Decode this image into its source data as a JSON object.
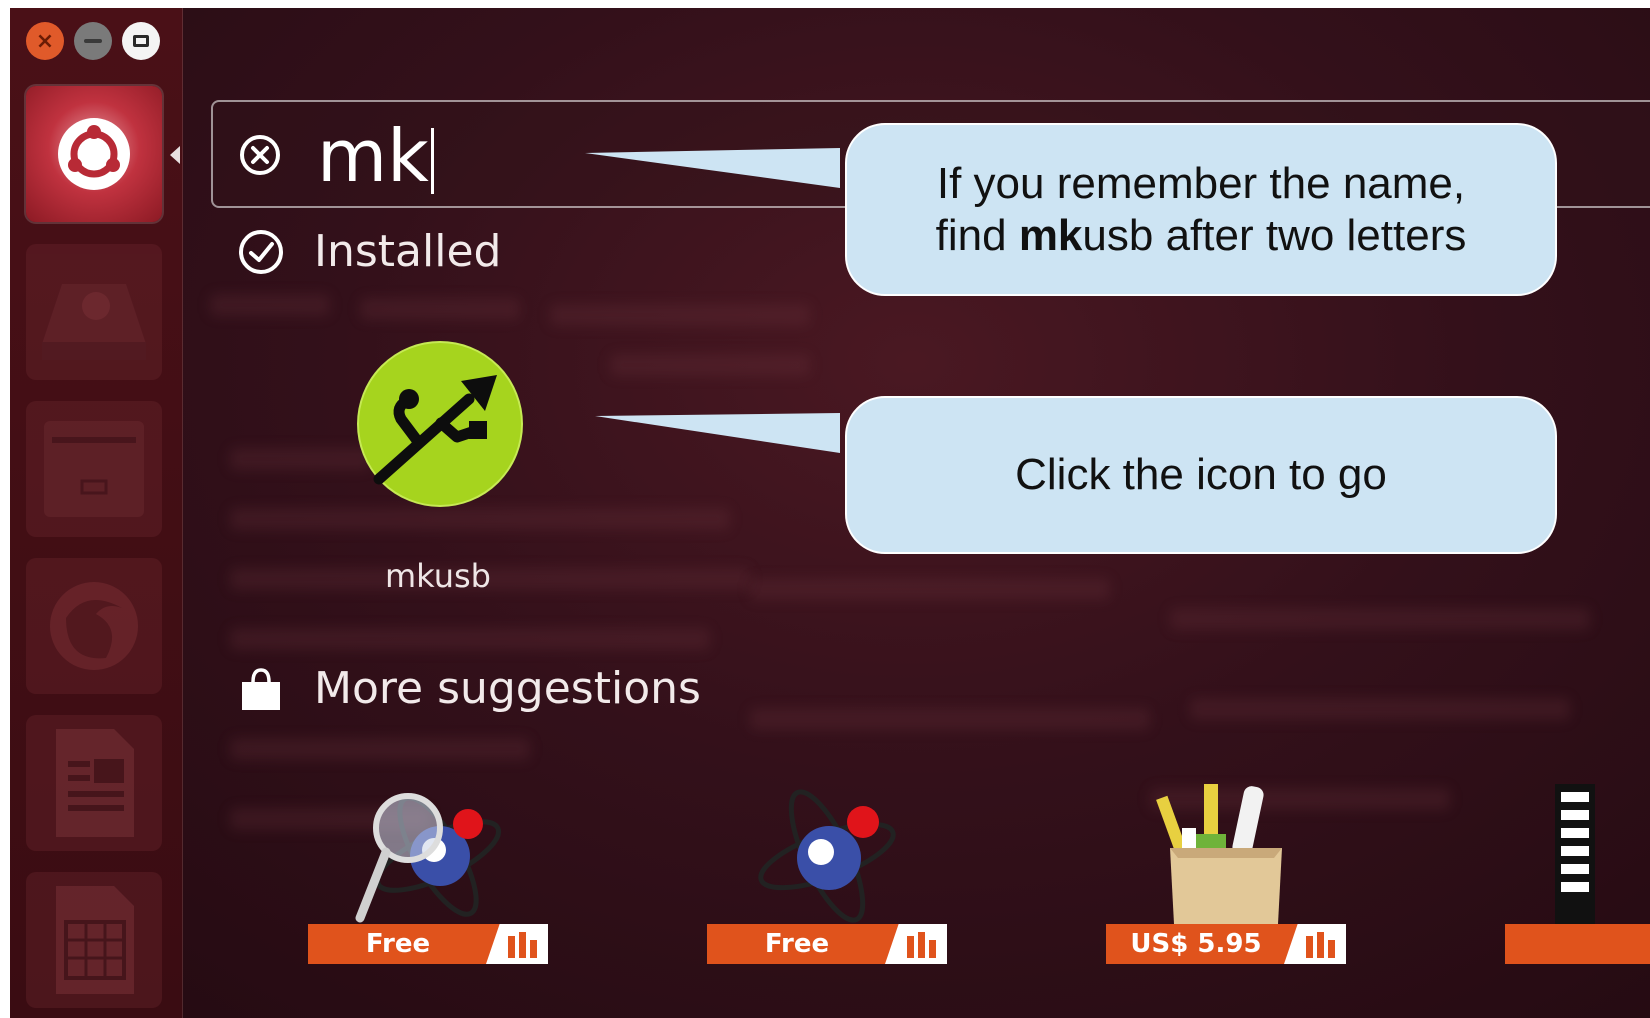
{
  "window": {
    "buttons": [
      {
        "name": "close",
        "icon": "close-icon",
        "color": "#e05a2a"
      },
      {
        "name": "minimize",
        "icon": "minimize-icon",
        "color": "#7a7a7a"
      },
      {
        "name": "maximize",
        "icon": "maximize-icon",
        "color": "#f4f4f4"
      }
    ]
  },
  "launcher": {
    "items": [
      {
        "icon": "ubuntu-dash-icon",
        "active": true
      },
      {
        "icon": "file-manager-icon",
        "active": false
      },
      {
        "icon": "archive-icon",
        "active": false
      },
      {
        "icon": "firefox-icon",
        "active": false
      },
      {
        "icon": "writer-document-icon",
        "active": false
      },
      {
        "icon": "calc-spreadsheet-icon",
        "active": false
      }
    ]
  },
  "search": {
    "query": "mk",
    "clear_icon": "clear-search-icon"
  },
  "installed": {
    "heading": "Installed",
    "icon": "check-circle-icon",
    "apps": [
      {
        "label": "mkusb",
        "icon": "usb-icon",
        "icon_color": "#a6d41e"
      }
    ]
  },
  "more_suggestions": {
    "heading": "More suggestions",
    "icon": "shopping-bag-icon",
    "items": [
      {
        "price": "Free",
        "icon": "molecule-search-icon"
      },
      {
        "price": "Free",
        "icon": "molecule-icon"
      },
      {
        "price": "US$ 5.95",
        "icon": "tools-box-icon"
      },
      {
        "price": "",
        "icon": "partial-app-icon"
      }
    ]
  },
  "callouts": {
    "first_line1": "If you remember the name,",
    "first_line2_prefix": "find ",
    "first_line2_bold": "mk",
    "first_line2_suffix": "usb after two letters",
    "second": "Click the icon to go"
  },
  "colors": {
    "accent": "#e0531c",
    "callout_bg": "#cde4f3",
    "background": "#2a0c14"
  }
}
